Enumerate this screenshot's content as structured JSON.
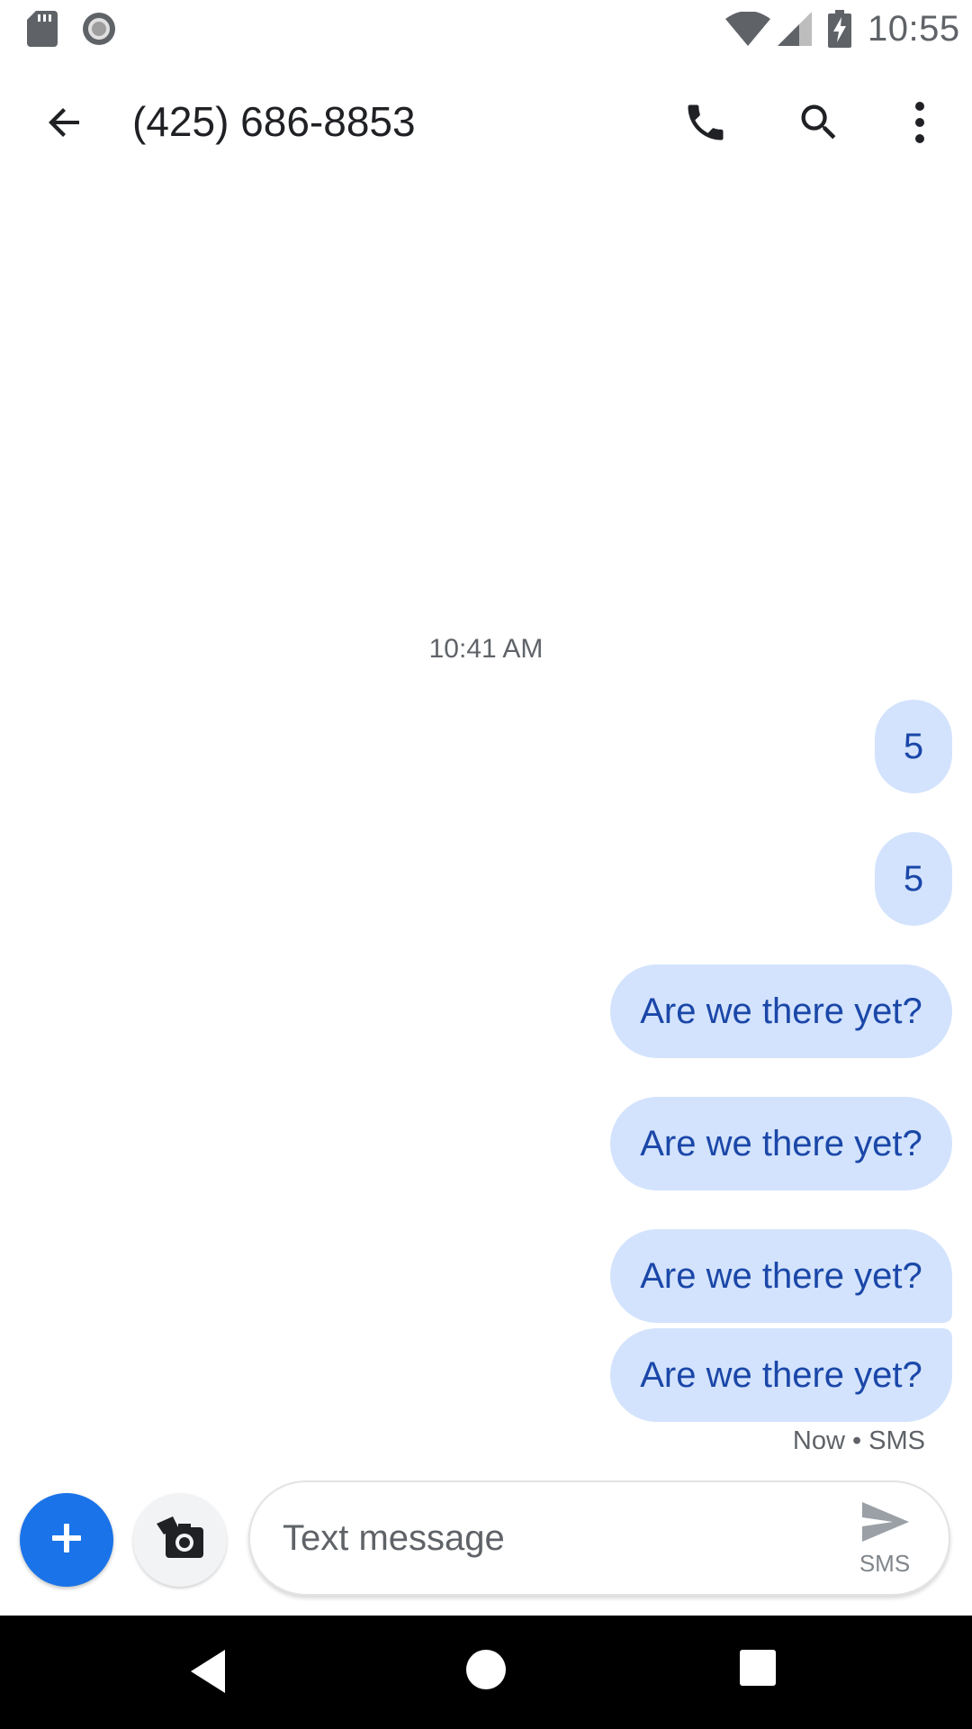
{
  "status_bar": {
    "time": "10:55",
    "icons": [
      "sd-card-icon",
      "record-icon",
      "wifi-icon",
      "signal-icon",
      "battery-charging-icon"
    ]
  },
  "header": {
    "title": "(425) 686-8853",
    "back_icon": "arrow-back-icon",
    "call_icon": "phone-icon",
    "search_icon": "search-icon",
    "more_icon": "more-vert-icon"
  },
  "conversation": {
    "timestamp": "10:41 AM",
    "messages": [
      {
        "text": "5"
      },
      {
        "text": "5"
      },
      {
        "text": "Are we there yet?"
      },
      {
        "text": "Are we there yet?"
      },
      {
        "text": "Are we there yet?"
      },
      {
        "text": "Are we there yet?"
      }
    ],
    "last_status": "Now • SMS"
  },
  "compose": {
    "placeholder": "Text message",
    "value": "",
    "send_label": "SMS",
    "add_icon": "plus-icon",
    "camera_icon": "camera-gallery-icon",
    "send_icon": "send-icon"
  },
  "colors": {
    "bubble_bg": "#d3e3fd",
    "bubble_text": "#1a47a8",
    "accent": "#1a73e8",
    "nav_bar": "#000000"
  }
}
